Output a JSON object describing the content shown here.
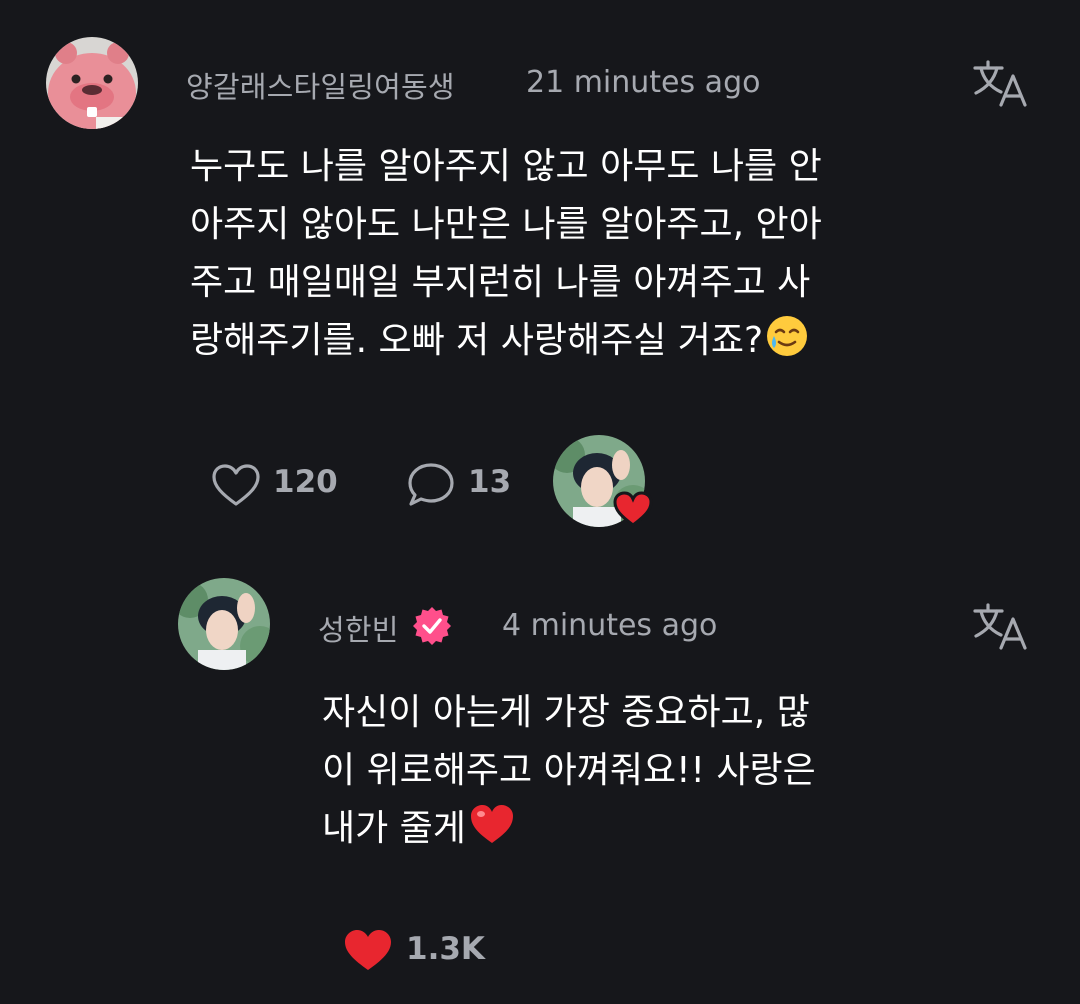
{
  "comment": {
    "username": "양갈래스타일링여동생",
    "timestamp": "21 minutes ago",
    "text_lines": [
      "누구도 나를 알아주지 않고 아무도 나를 안",
      "아주지 않아도 나만은 나를 알아주고, 안아",
      "주고 매일매일 부지런히 나를 아껴주고 사",
      "랑해주기를. 오빠 저 사랑해주실 거죠?"
    ],
    "trailing_emoji": "smiling-face-with-tear",
    "likes": "120",
    "replies": "13"
  },
  "reply": {
    "username": "성한빈",
    "verified": true,
    "timestamp": "4 minutes ago",
    "text_lines": [
      "자신이 아는게 가장 중요하고, 많",
      "이 위로해주고 아껴줘요!! 사랑은",
      "내가 줄게"
    ],
    "trailing_emoji": "red-heart",
    "likes": "1.3K",
    "liked": true
  },
  "colors": {
    "background": "#16171b",
    "muted_text": "#a6a9b0",
    "verified_badge": "#ff4f8b",
    "heart_red": "#e8262f",
    "avatar_pink": "#e9909a"
  }
}
